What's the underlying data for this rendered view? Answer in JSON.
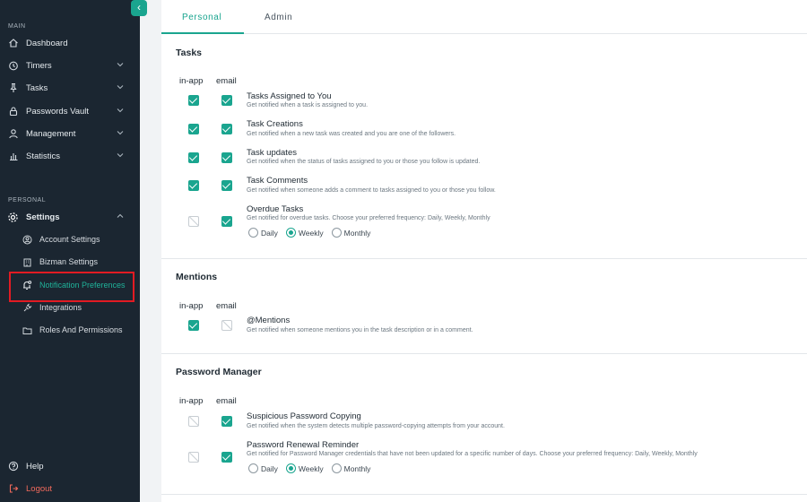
{
  "sidebar": {
    "collapse_icon": "‹",
    "main_label": "MAIN",
    "personal_label": "PERSONAL",
    "items": {
      "dashboard": "Dashboard",
      "timers": "Timers",
      "tasks": "Tasks",
      "passwords_vault": "Passwords Vault",
      "management": "Management",
      "statistics": "Statistics",
      "settings": "Settings",
      "help": "Help",
      "logout": "Logout"
    },
    "settings_sub": {
      "account": "Account Settings",
      "bizman": "Bizman Settings",
      "notification": "Notification Preferences",
      "integrations": "Integrations",
      "roles": "Roles And Permissions"
    },
    "accent_color": "#1aa58f",
    "highlight_color": "#e21b23"
  },
  "tabs": {
    "personal": "Personal",
    "admin": "Admin"
  },
  "columns": {
    "inapp": "in-app",
    "email": "email"
  },
  "radio_options": {
    "daily": "Daily",
    "weekly": "Weekly",
    "monthly": "Monthly"
  },
  "sections": {
    "tasks": {
      "title": "Tasks",
      "rows": [
        {
          "title": "Tasks Assigned to You",
          "desc": "Get notified when a task is assigned to you.",
          "inapp": true,
          "email": true
        },
        {
          "title": "Task Creations",
          "desc": "Get notified when a new task was created and you are one of the followers.",
          "inapp": true,
          "email": true
        },
        {
          "title": "Task updates",
          "desc": "Get notified when the status of tasks assigned to you or those you follow is updated.",
          "inapp": true,
          "email": true
        },
        {
          "title": "Task Comments",
          "desc": "Get notified when someone adds a comment to tasks assigned to you or those you follow.",
          "inapp": true,
          "email": true
        },
        {
          "title": "Overdue Tasks",
          "desc": "Get notified for overdue tasks. Choose your preferred frequency: Daily, Weekly, Monthly",
          "inapp": false,
          "email": true,
          "frequency": "Weekly"
        }
      ]
    },
    "mentions": {
      "title": "Mentions",
      "rows": [
        {
          "title": "@Mentions",
          "desc": "Get notified when someone mentions you in the task description or in a comment.",
          "inapp": true,
          "email": false
        }
      ]
    },
    "password": {
      "title": "Password Manager",
      "rows": [
        {
          "title": "Suspicious Password Copying",
          "desc": "Get notified when the system detects multiple password-copying attempts from your account.",
          "inapp": false,
          "email": true
        },
        {
          "title": "Password Renewal Reminder",
          "desc": "Get notified for Password Manager credentials that have not been updated for a specific number of days. Choose your preferred frequency: Daily, Weekly, Monthly",
          "inapp": false,
          "email": true,
          "frequency": "Weekly"
        }
      ]
    }
  }
}
